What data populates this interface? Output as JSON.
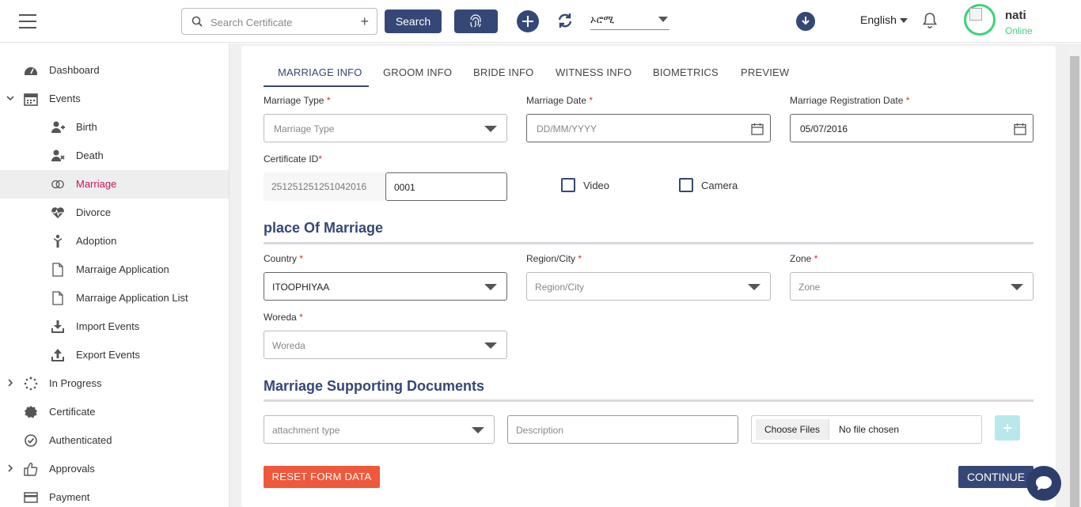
{
  "header": {
    "search_placeholder": "Search Certificate",
    "search_button": "Search",
    "language_select_value": "ኦሮሚ",
    "language_label": "English",
    "user_name": "nati",
    "user_status": "Online",
    "icons": [
      "menu-icon",
      "search-icon",
      "plus-icon",
      "fingerprint-icon",
      "add-icon",
      "refresh-icon",
      "download-icon",
      "bell-icon",
      "avatar"
    ]
  },
  "sidebar": {
    "items": [
      {
        "label": "Dashboard",
        "icon": "dashboard-icon"
      },
      {
        "label": "Events",
        "icon": "calendar-icon",
        "expanded": true
      },
      {
        "label": "Birth",
        "icon": "add-person-icon"
      },
      {
        "label": "Death",
        "icon": "remove-person-icon"
      },
      {
        "label": "Marriage",
        "icon": "marriage-icon",
        "active": true
      },
      {
        "label": "Divorce",
        "icon": "heartbeat-icon"
      },
      {
        "label": "Adoption",
        "icon": "child-icon"
      },
      {
        "label": "Marraige Application",
        "icon": "document-icon"
      },
      {
        "label": "Marraige Application List",
        "icon": "document-icon"
      },
      {
        "label": "Import Events",
        "icon": "import-icon"
      },
      {
        "label": "Export Events",
        "icon": "export-icon"
      },
      {
        "label": "In Progress",
        "icon": "spinner-icon"
      },
      {
        "label": "Certificate",
        "icon": "certificate-icon"
      },
      {
        "label": "Authenticated",
        "icon": "check-circle-icon"
      },
      {
        "label": "Approvals",
        "icon": "thumbs-up-icon"
      },
      {
        "label": "Payment",
        "icon": "credit-card-icon"
      }
    ]
  },
  "tabs": [
    "MARRIAGE INFO",
    "GROOM INFO",
    "BRIDE INFO",
    "WITNESS INFO",
    "BIOMETRICS",
    "PREVIEW"
  ],
  "form": {
    "marriage_type": {
      "label": "Marriage Type",
      "placeholder": "Marriage Type"
    },
    "marriage_date": {
      "label": "Marriage Date",
      "placeholder": "DD/MM/YYYY"
    },
    "registration_date": {
      "label": "Marriage Registration Date",
      "value": "05/07/2016"
    },
    "certificate_id": {
      "label": "Certificate ID",
      "prefix": "251251251251042016",
      "value": "0001"
    },
    "video_label": "Video",
    "camera_label": "Camera",
    "place_title": "place Of Marriage",
    "country": {
      "label": "Country",
      "value": "ITOOPHIYAA"
    },
    "region": {
      "label": "Region/City",
      "placeholder": "Region/City"
    },
    "zone": {
      "label": "Zone",
      "placeholder": "Zone"
    },
    "woreda": {
      "label": "Woreda",
      "placeholder": "Woreda"
    },
    "docs_title": "Marriage Supporting Documents",
    "attachment_placeholder": "attachment type",
    "description_placeholder": "Description",
    "choose_files": "Choose Files",
    "no_file": "No file chosen",
    "required_mark": "*"
  },
  "actions": {
    "reset": "RESET FORM DATA",
    "continue": "CONTINUE"
  },
  "colors": {
    "primary": "#354776",
    "accent_active": "#c2185b",
    "reset": "#f0583c",
    "online": "#3dd27a",
    "required": "#d32f2f"
  }
}
